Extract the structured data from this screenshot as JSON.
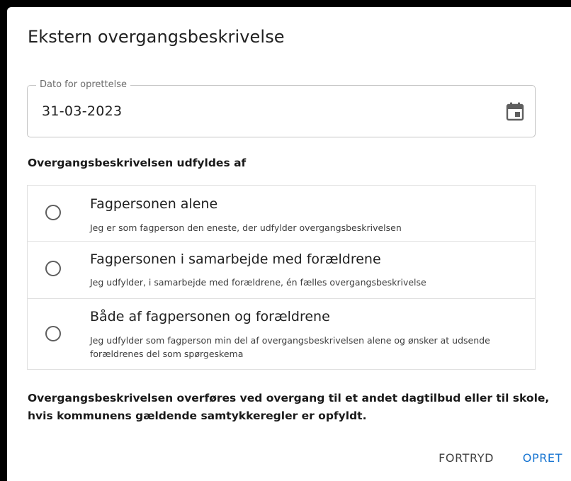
{
  "dialog": {
    "title": "Ekstern overgangsbeskrivelse"
  },
  "date_field": {
    "label": "Dato for oprettelse",
    "value": "31-03-2023",
    "icon": "calendar-icon"
  },
  "fill_section": {
    "heading": "Overgangsbeskrivelsen udfyldes af",
    "options": [
      {
        "title": "Fagpersonen alene",
        "description": "Jeg er som fagperson den eneste, der udfylder overgangsbeskrivelsen",
        "selected": false
      },
      {
        "title": "Fagpersonen i samarbejde med forældrene",
        "description": "Jeg udfylder, i samarbejde med forældrene, én fælles overgangsbeskrivelse",
        "selected": false
      },
      {
        "title": "Både af fagpersonen og forældrene",
        "description": "Jeg udfylder som fagperson min del af overgangsbeskrivelsen alene og ønsker at udsende forældrenes del som spørgeskema",
        "selected": false
      }
    ]
  },
  "footer_note": "Overgangsbeskrivelsen overføres ved overgang til et andet dagtilbud eller til skole, hvis kommunens gældende samtykkeregler er opfyldt.",
  "actions": {
    "cancel_label": "FORTRYD",
    "create_label": "OPRET"
  },
  "colors": {
    "primary": "#1976d2",
    "text": "#212121",
    "border": "#e0e0e0"
  }
}
